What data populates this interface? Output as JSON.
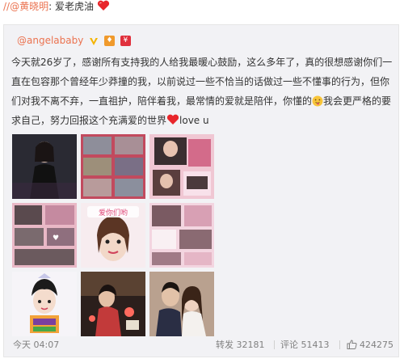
{
  "header": {
    "slash": "//",
    "mention": "@黄晓明",
    "colon": ":",
    "text": "爱老虎油"
  },
  "original_post": {
    "username": "@angelababy",
    "badges": [
      "verified-v-icon",
      "gift-badge-icon",
      "red-envelope-badge-icon"
    ],
    "text_before_emoji": "今天就26岁了，感谢所有支持我的人给我最暖心鼓励，这么多年了，真的很想感谢你们一直在包容那个曾经年少莽撞的我，以前说过一些不恰当的话做过一些不懂事的行为，但你们对我不离不弃，一直祖护，陪伴着我，最常情的爱就是陪伴，你懂的",
    "text_middle": "我会更严格的要求自己，努力回报这个充满爱的世界",
    "text_end": "love u",
    "image_caption_2_2": "爱你们哟"
  },
  "footer": {
    "time": "今天 04:07",
    "repost_label": "转发",
    "repost_count": "32181",
    "comment_label": "评论",
    "comment_count": "51413",
    "like_count": "424275"
  },
  "colors": {
    "accent": "#eb7350",
    "panel_bg": "#f2f2f5",
    "heart": "#e8262b"
  }
}
